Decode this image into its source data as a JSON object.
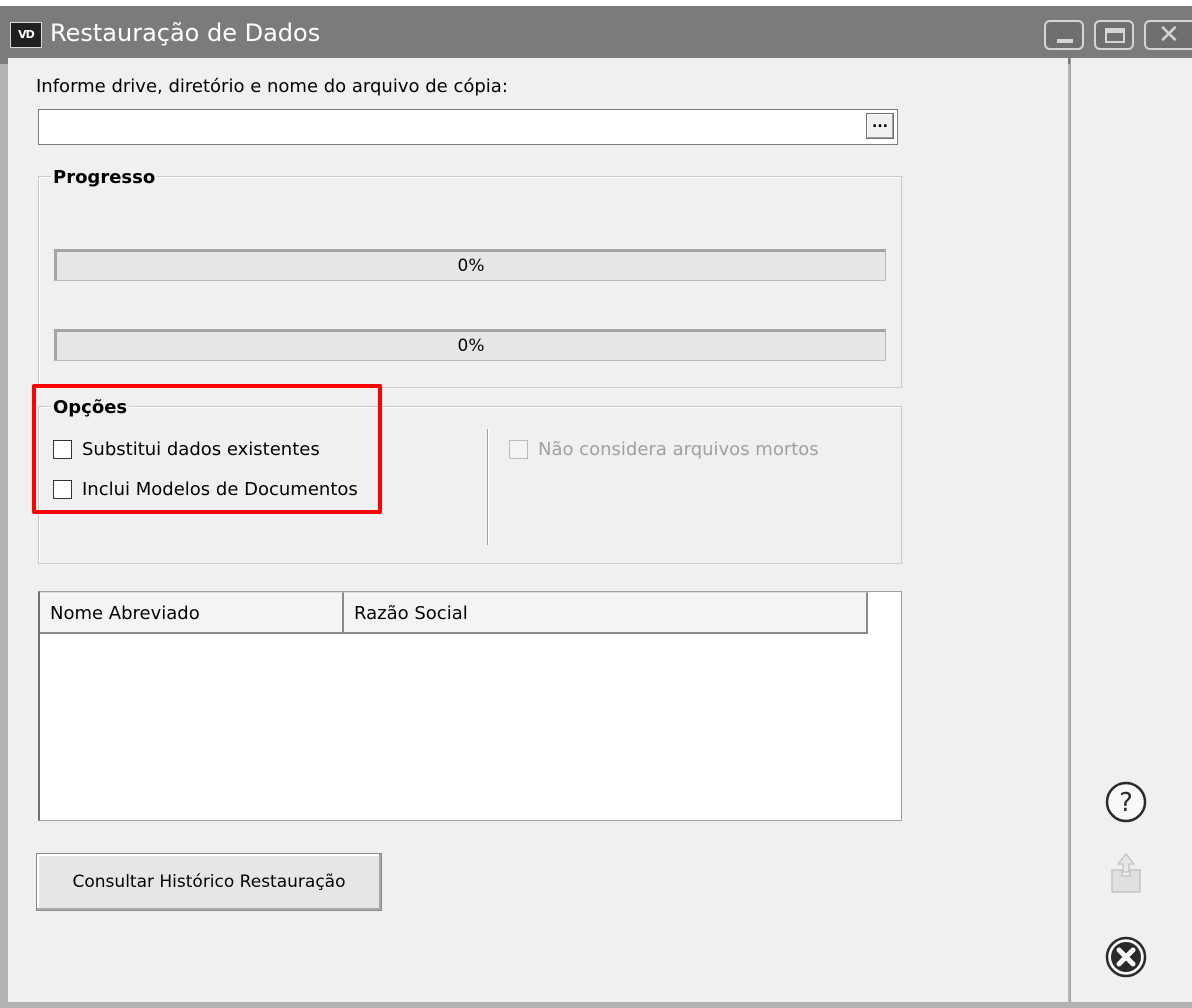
{
  "window": {
    "title": "Restauração de Dados",
    "app_icon_text": "VD"
  },
  "file": {
    "label": "Informe drive, diretório e nome do arquivo de cópia:",
    "value": "",
    "browse_label": "..."
  },
  "progress": {
    "title": "Progresso",
    "bars": [
      {
        "value_percent": 0,
        "text": "0%"
      },
      {
        "value_percent": 0,
        "text": "0%"
      }
    ]
  },
  "options": {
    "title": "Opções",
    "items": [
      {
        "label": "Substitui dados existentes",
        "checked": false,
        "enabled": true
      },
      {
        "label": "Inclui Modelos de Documentos",
        "checked": false,
        "enabled": true
      },
      {
        "label": "Não considera arquivos mortos",
        "checked": false,
        "enabled": false
      }
    ]
  },
  "table": {
    "columns": [
      "Nome Abreviado",
      "Razão Social"
    ],
    "rows": []
  },
  "history_button": {
    "label": "Consultar Histórico Restauração"
  },
  "sidebar": {
    "icons": [
      "help-icon",
      "export-icon",
      "exit-icon"
    ]
  },
  "colors": {
    "titlebar": "#7b7b7b",
    "client_bg": "#f0f0f0",
    "highlight": "#ff0000",
    "progress_fill": "#06b025"
  }
}
